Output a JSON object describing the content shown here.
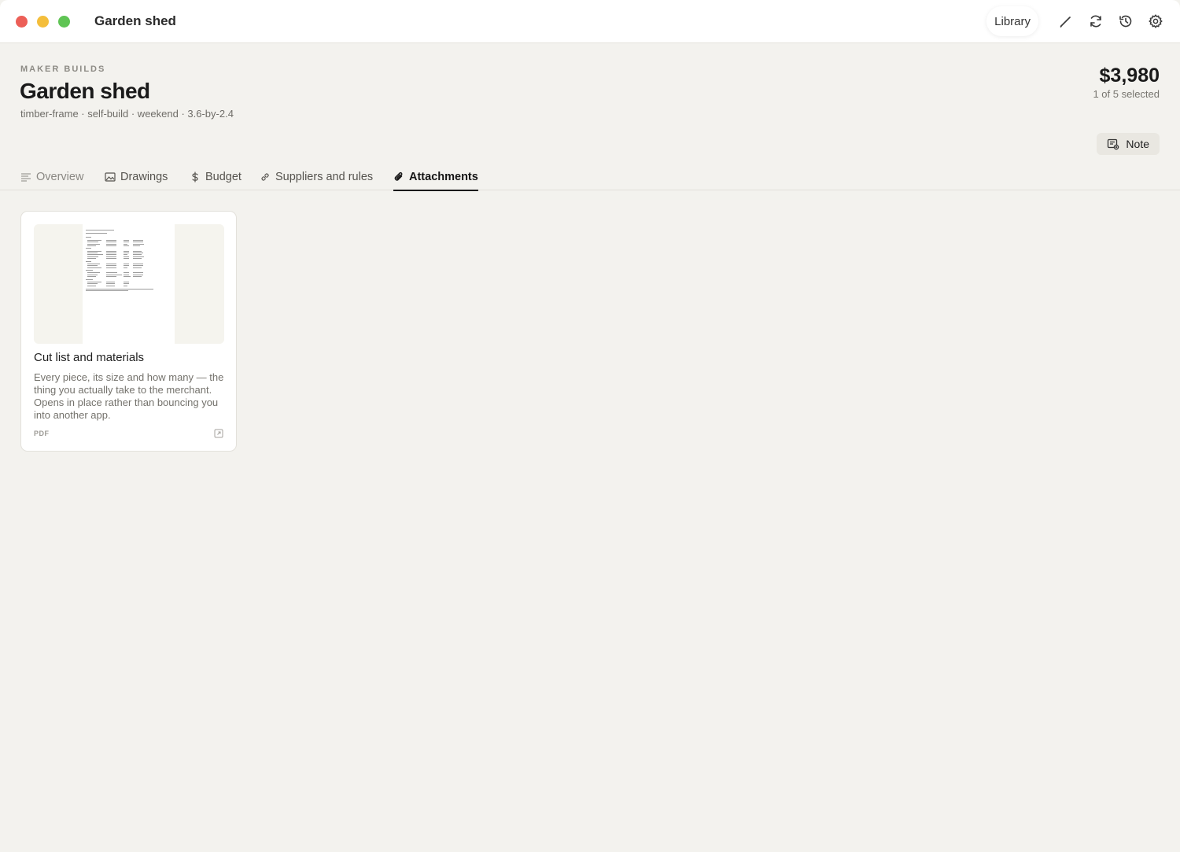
{
  "window": {
    "title": "Garden shed",
    "toolbar": {
      "library_label": "Library",
      "icons": [
        "pencil-icon",
        "sync-icon",
        "history-icon",
        "gear-icon"
      ]
    }
  },
  "header": {
    "eyebrow": "MAKER BUILDS",
    "title": "Garden shed",
    "tags": "timber-frame · self-build · weekend · 3.6-by-2.4",
    "price": "$3,980",
    "selection": "1 of 5 selected",
    "note_label": "Note"
  },
  "tabs": [
    {
      "label": "Overview",
      "icon": "list-icon",
      "active": false
    },
    {
      "label": "Drawings",
      "icon": "image-icon",
      "active": false
    },
    {
      "label": "Budget",
      "icon": "dollar-icon",
      "active": false
    },
    {
      "label": "Suppliers and rules",
      "icon": "link-icon",
      "active": false
    },
    {
      "label": "Attachments",
      "icon": "paperclip-icon",
      "active": true
    }
  ],
  "attachments": [
    {
      "title": "Cut list and materials",
      "description": "Every piece, its size and how many — the thing you actually take to the merchant. Opens in place rather than bouncing you into another app.",
      "type": "PDF"
    }
  ],
  "colors": {
    "background": "#f3f2ee",
    "titlebar": "#ffffff",
    "traffic_red": "#ec5f57",
    "traffic_yellow": "#f4be3b",
    "traffic_green": "#5fc454",
    "active_tab": "#1a1a1a"
  }
}
